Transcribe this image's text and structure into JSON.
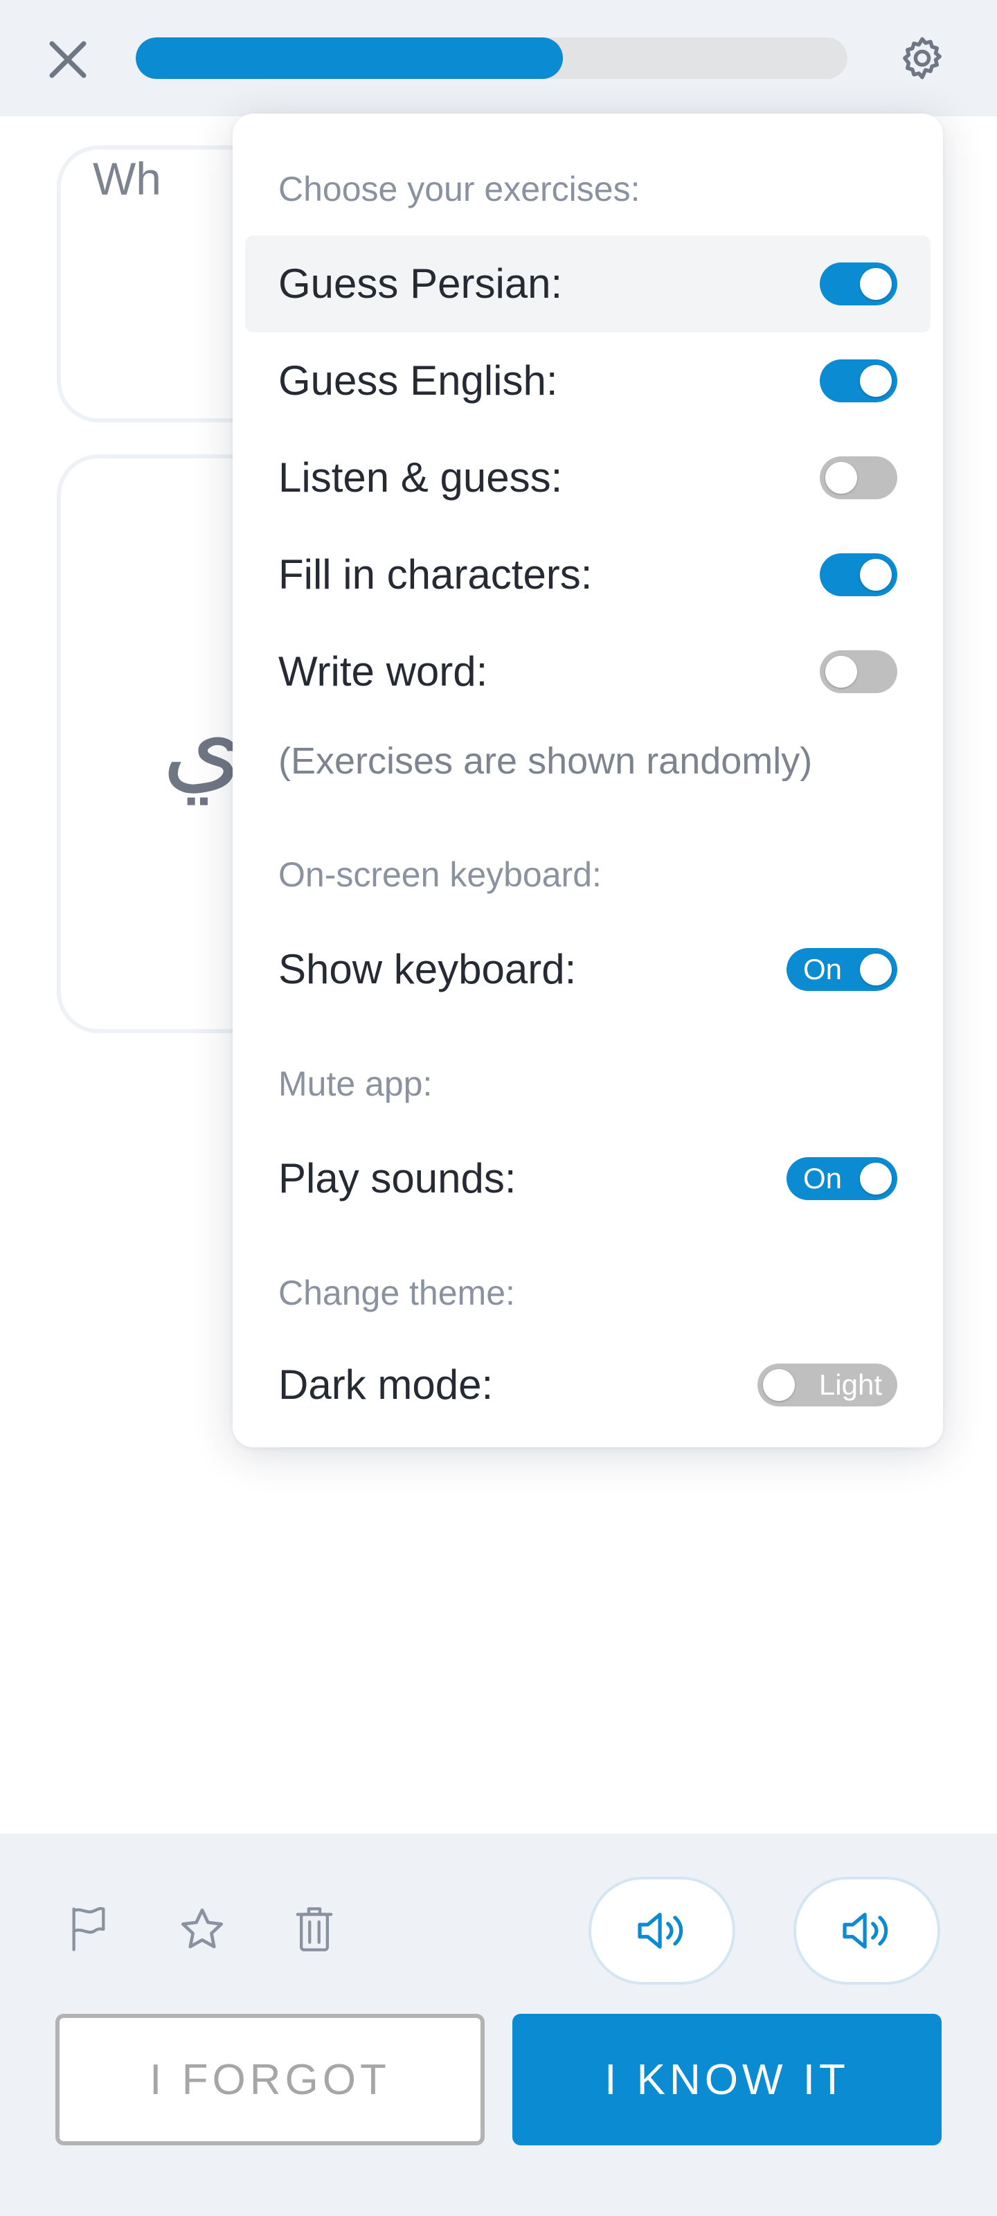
{
  "header": {
    "close_icon": "close-icon",
    "settings_icon": "gear-icon",
    "progress_fraction": 0.6
  },
  "card": {
    "question_fragment": "Wh",
    "word_fragment": "؟ي"
  },
  "settings": {
    "exercises_label": "Choose your exercises:",
    "exercises": [
      {
        "label": "Guess Persian:",
        "enabled": true
      },
      {
        "label": "Guess English:",
        "enabled": true
      },
      {
        "label": "Listen & guess:",
        "enabled": false
      },
      {
        "label": "Fill in characters:",
        "enabled": true
      },
      {
        "label": "Write word:",
        "enabled": false
      }
    ],
    "random_note": "(Exercises are shown randomly)",
    "keyboard_section": "On-screen keyboard:",
    "keyboard": {
      "label": "Show keyboard:",
      "state": "On"
    },
    "mute_section": "Mute app:",
    "sounds": {
      "label": "Play sounds:",
      "state": "On"
    },
    "theme_section": "Change theme:",
    "theme": {
      "label": "Dark mode:",
      "state": "Light"
    }
  },
  "bottom": {
    "icons": [
      "flag-icon",
      "star-icon",
      "trash-icon"
    ],
    "sound_buttons": [
      "speaker-icon",
      "speaker-icon"
    ],
    "forgot_label": "I FORGOT",
    "know_label": "I KNOW IT"
  },
  "colors": {
    "accent": "#0b8bd1",
    "toggle_off": "#bfbfbf",
    "bar_background": "#eef2f6"
  }
}
